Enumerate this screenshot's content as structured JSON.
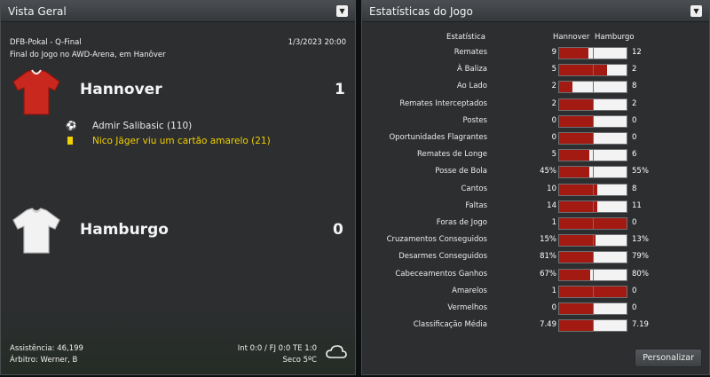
{
  "overview": {
    "title": "Vista Geral",
    "competition": "DFB-Pokal - Q-Final",
    "datetime": "1/3/2023 20:00",
    "venue": "Final do Jogo no AWD-Arena, em Hanôver",
    "home": {
      "name": "Hannover",
      "score": "1",
      "shirt_color": "#c8281e"
    },
    "away": {
      "name": "Hamburgo",
      "score": "0",
      "shirt_color": "#f2f2f2"
    },
    "events": [
      {
        "icon": "ball-icon",
        "text": "Admir Salibasic (110)",
        "color": "#f0f0f0"
      },
      {
        "icon": "yellow-card-icon",
        "text": "Nico Jäger viu um cartão amarelo (21)",
        "color": "#f2d100"
      }
    ],
    "attendance": "Assistência: 46,199",
    "referee": "Árbitro: Werner, B",
    "halftime": "Int 0:0 / FJ 0:0 TE 1:0",
    "weather": "Seco 5ºC",
    "weather_icon": "cloud-icon"
  },
  "stats": {
    "title": "Estatísticas do Jogo",
    "header_label": "Estatística",
    "home_label": "Hannover",
    "away_label": "Hamburgo",
    "home_color": "#a31a12",
    "away_color": "#f3f3f3",
    "rows": [
      {
        "label": "Remates",
        "home": "9",
        "away": "12",
        "home_share": 0.43
      },
      {
        "label": "À Baliza",
        "home": "5",
        "away": "2",
        "home_share": 0.71
      },
      {
        "label": "Ao Lado",
        "home": "2",
        "away": "8",
        "home_share": 0.2
      },
      {
        "label": "Remates Interceptados",
        "home": "2",
        "away": "2",
        "home_share": 0.5
      },
      {
        "label": "Postes",
        "home": "0",
        "away": "0",
        "home_share": 0.5
      },
      {
        "label": "Oportunidades Flagrantes",
        "home": "0",
        "away": "0",
        "home_share": 0.5
      },
      {
        "label": "Remates de Longe",
        "home": "5",
        "away": "6",
        "home_share": 0.45
      },
      {
        "label": "Posse de Bola",
        "home": "45%",
        "away": "55%",
        "home_share": 0.45
      },
      {
        "label": "Cantos",
        "home": "10",
        "away": "8",
        "home_share": 0.56
      },
      {
        "label": "Faltas",
        "home": "14",
        "away": "11",
        "home_share": 0.56
      },
      {
        "label": "Foras de Jogo",
        "home": "1",
        "away": "0",
        "home_share": 1.0
      },
      {
        "label": "Cruzamentos Conseguidos",
        "home": "15%",
        "away": "13%",
        "home_share": 0.54
      },
      {
        "label": "Desarmes Conseguidos",
        "home": "81%",
        "away": "79%",
        "home_share": 0.51
      },
      {
        "label": "Cabeceamentos Ganhos",
        "home": "67%",
        "away": "80%",
        "home_share": 0.46
      },
      {
        "label": "Amarelos",
        "home": "1",
        "away": "0",
        "home_share": 1.0
      },
      {
        "label": "Vermelhos",
        "home": "0",
        "away": "0",
        "home_share": 0.5
      },
      {
        "label": "Classificação Média",
        "home": "7.49",
        "away": "7.19",
        "home_share": 0.51
      }
    ],
    "customize_label": "Personalizar"
  }
}
